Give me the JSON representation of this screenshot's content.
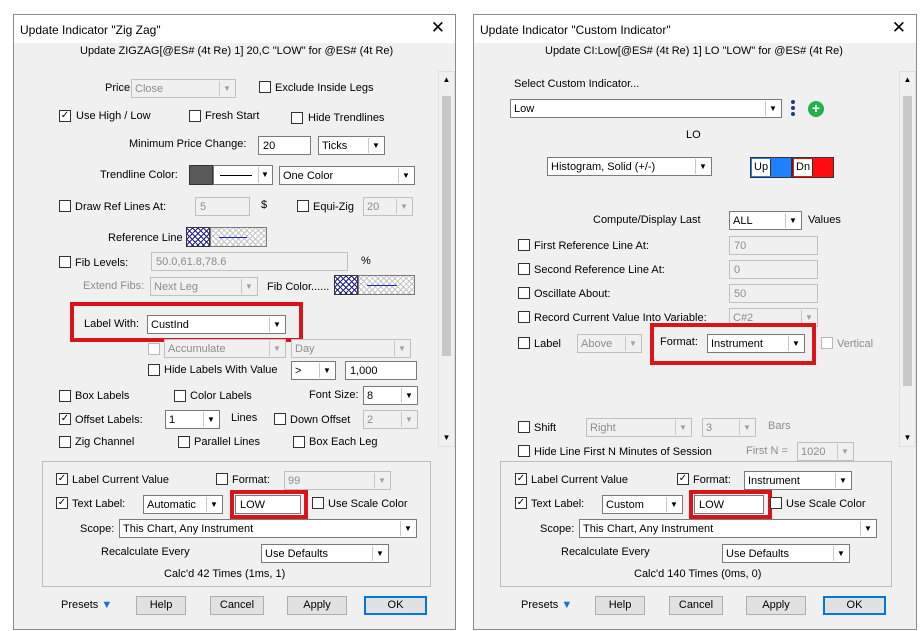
{
  "left": {
    "title": "Update Indicator \"Zig Zag\"",
    "subtitle": "Update ZIGZAG[@ES# (4t Re) 1] 20,C  \"LOW\" for @ES# (4t Re)",
    "price_label": "Price:",
    "price_value": "Close",
    "exclude_inside_legs": "Exclude Inside Legs",
    "use_high_low": "Use High / Low",
    "fresh_start": "Fresh Start",
    "hide_trendlines": "Hide Trendlines",
    "min_price_change_label": "Minimum Price Change:",
    "min_price_change_value": "20",
    "ticks_value": "Ticks",
    "trendline_color_label": "Trendline Color:",
    "one_color": "One Color",
    "draw_ref_lines": "Draw Ref Lines At:",
    "ref_lines_value": "5",
    "dollar": "$",
    "equi_zig": "Equi-Zig",
    "equi_zig_value": "20",
    "reference_line": "Reference Line",
    "fib_levels": "Fib Levels:",
    "fib_levels_value": "50.0,61.8,78.6",
    "percent": "%",
    "extend_fibs": "Extend Fibs:",
    "extend_fibs_value": "Next Leg",
    "fib_color": "Fib Color......",
    "label_with": "Label With:",
    "label_with_value": "CustInd",
    "accumulate": "Accumulate",
    "day": "Day",
    "hide_labels_with_value": "Hide Labels With Value",
    "hide_labels_op": ">",
    "hide_labels_value": "1,000",
    "box_labels": "Box Labels",
    "color_labels": "Color Labels",
    "font_size_label": "Font Size:",
    "font_size_value": "8",
    "offset_labels": "Offset Labels:",
    "offset_labels_value": "1",
    "lines": "Lines",
    "down_offset": "Down Offset",
    "down_offset_value": "2",
    "zig_channel": "Zig Channel",
    "parallel_lines": "Parallel Lines",
    "box_each_leg": "Box Each Leg",
    "label_current_value": "Label Current Value",
    "format_label": "Format:",
    "format_value": "99",
    "text_label": "Text Label:",
    "text_label_mode": "Automatic",
    "text_label_value": "LOW",
    "use_scale_color": "Use Scale Color",
    "scope_label": "Scope:",
    "scope_value": "This Chart, Any Instrument",
    "recalc_label": "Recalculate Every",
    "recalc_value": "Use Defaults",
    "calcd": "Calc'd 42 Times (1ms, 1)",
    "presets": "Presets",
    "help": "Help",
    "cancel": "Cancel",
    "apply": "Apply",
    "ok": "OK",
    "close_glyph": "✕"
  },
  "right": {
    "title": "Update Indicator \"Custom Indicator\"",
    "subtitle": "Update CI:Low[@ES# (4t Re) 1] LO \"LOW\" for @ES# (4t Re)",
    "select_label": "Select Custom Indicator...",
    "select_value": "Low",
    "lo": "LO",
    "style_value": "Histogram, Solid (+/-)",
    "up": "Up",
    "dn": "Dn",
    "compute_label": "Compute/Display Last",
    "compute_value": "ALL",
    "values": "Values",
    "first_ref": "First Reference Line At:",
    "first_ref_value": "70",
    "second_ref": "Second Reference Line At:",
    "second_ref_value": "0",
    "oscillate": "Oscillate About:",
    "oscillate_value": "50",
    "record": "Record Current Value Into Variable:",
    "record_value": "C#2",
    "label": "Label",
    "label_pos": "Above",
    "format_label": "Format:",
    "format_value": "Instrument",
    "vertical": "Vertical",
    "shift": "Shift",
    "shift_dir": "Right",
    "shift_value": "3",
    "bars": "Bars",
    "hide_line": "Hide Line First N Minutes of Session",
    "first_n": "First N =",
    "first_n_value": "1020",
    "label_current_value": "Label Current Value",
    "format2_label": "Format:",
    "format2_value": "Instrument",
    "text_label": "Text Label:",
    "text_label_mode": "Custom",
    "text_label_value": "LOW",
    "use_scale_color": "Use Scale Color",
    "scope_label": "Scope:",
    "scope_value": "This Chart, Any Instrument",
    "recalc_label": "Recalculate Every",
    "recalc_value": "Use Defaults",
    "calcd": "Calc'd 140 Times (0ms, 0)",
    "presets": "Presets",
    "help": "Help",
    "cancel": "Cancel",
    "apply": "Apply",
    "ok": "OK",
    "close_glyph": "✕"
  },
  "colors": {
    "highlight": "#d9141b",
    "up_color": "#1e7fff",
    "dn_color": "#ff0d0d",
    "plus_icon": "#22b14c"
  }
}
